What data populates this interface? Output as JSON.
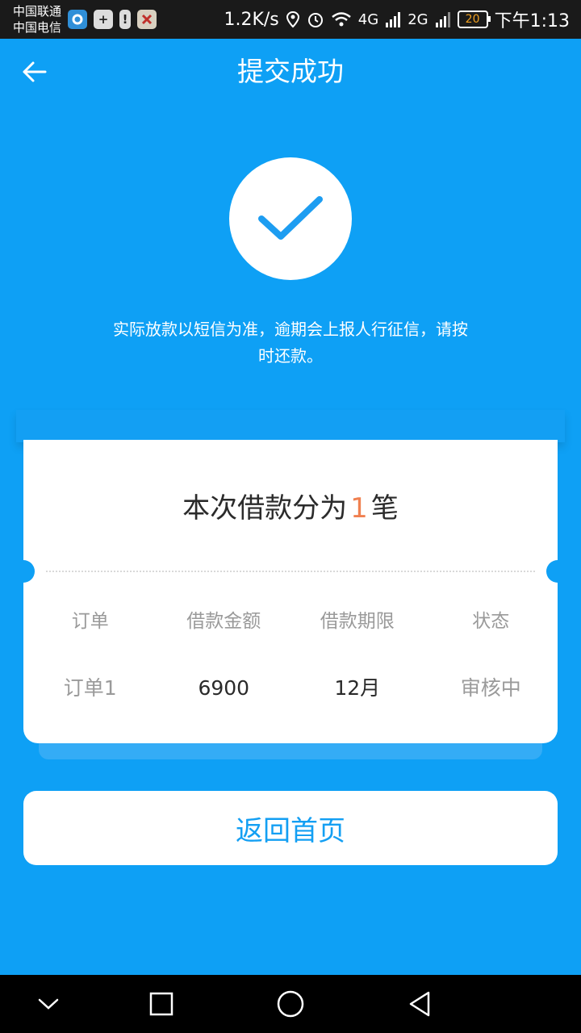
{
  "status_bar": {
    "carrier_1": "中国联通",
    "carrier_2": "中国电信",
    "net_speed": "1.2K/s",
    "network_4g": "4G",
    "network_2g": "2G",
    "battery": "20",
    "time": "下午1:13"
  },
  "header": {
    "title": "提交成功",
    "back_icon": "arrow-left-icon"
  },
  "success": {
    "icon": "check-icon",
    "notice_line1": "实际放款以短信为准，逾期会上报人行征信，请按",
    "notice_line2": "时还款。"
  },
  "split_card": {
    "title_prefix": "本次借款分为",
    "count": "1",
    "title_suffix": "笔",
    "columns": [
      "订单",
      "借款金额",
      "借款期限",
      "状态"
    ],
    "rows": [
      {
        "order": "订单1",
        "amount": "6900",
        "term": "12月",
        "status": "审核中"
      }
    ]
  },
  "actions": {
    "home_label": "返回首页"
  },
  "colors": {
    "background": "#0ea0f5",
    "accent": "#139ff3",
    "count_highlight": "#f08050"
  },
  "nav_bar": {
    "icons": [
      "chevron-down-icon",
      "recent-apps-icon",
      "home-circle-icon",
      "back-triangle-icon"
    ]
  }
}
